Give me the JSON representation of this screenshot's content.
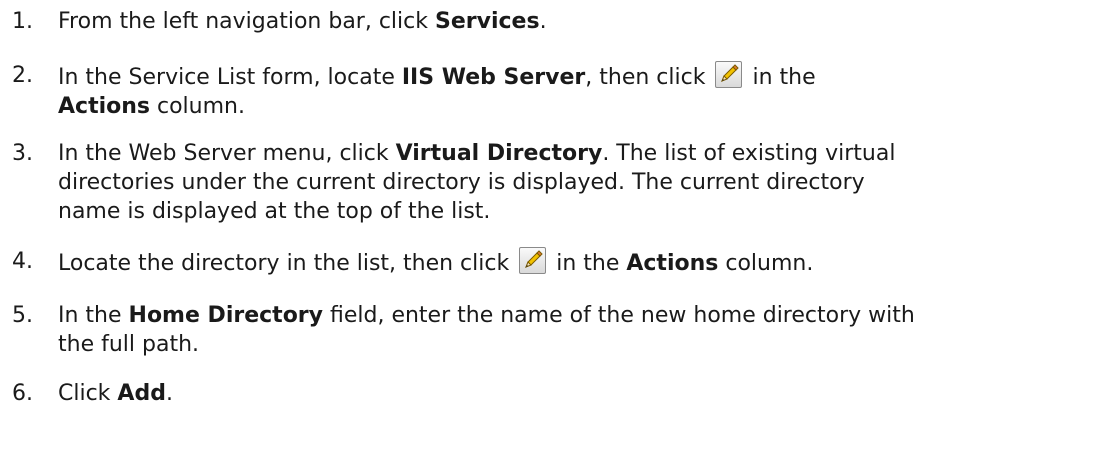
{
  "steps": [
    {
      "number": "1.",
      "lines": [
        [
          {
            "t": "From the left navigation bar, click "
          },
          {
            "b": "Services"
          },
          {
            "t": "."
          }
        ]
      ]
    },
    {
      "number": "2.",
      "lines": [
        [
          {
            "t": "In the Service List form, locate "
          },
          {
            "b": "IIS Web Server"
          },
          {
            "t": ", then click "
          },
          {
            "icon": "edit-pencil-icon"
          },
          {
            "t": " in the"
          }
        ],
        [
          {
            "b": "Actions"
          },
          {
            "t": " column."
          }
        ]
      ]
    },
    {
      "number": "3.",
      "lines": [
        [
          {
            "t": "In the Web Server menu, click "
          },
          {
            "b": "Virtual Directory"
          },
          {
            "t": ". The list of existing virtual"
          }
        ],
        [
          {
            "t": "directories under the current directory is displayed. The current directory"
          }
        ],
        [
          {
            "t": "name is displayed at the top of the list."
          }
        ]
      ]
    },
    {
      "number": "4.",
      "lines": [
        [
          {
            "t": "Locate the directory in the list, then click "
          },
          {
            "icon": "edit-pencil-icon"
          },
          {
            "t": " in the "
          },
          {
            "b": "Actions"
          },
          {
            "t": " column."
          }
        ]
      ]
    },
    {
      "number": "5.",
      "lines": [
        [
          {
            "t": "In the "
          },
          {
            "b": "Home Directory"
          },
          {
            "t": " field, enter the name of the new home directory with"
          }
        ],
        [
          {
            "t": "the full path."
          }
        ]
      ]
    },
    {
      "number": "6.",
      "lines": [
        [
          {
            "t": "Click "
          },
          {
            "b": "Add"
          },
          {
            "t": "."
          }
        ]
      ]
    }
  ]
}
